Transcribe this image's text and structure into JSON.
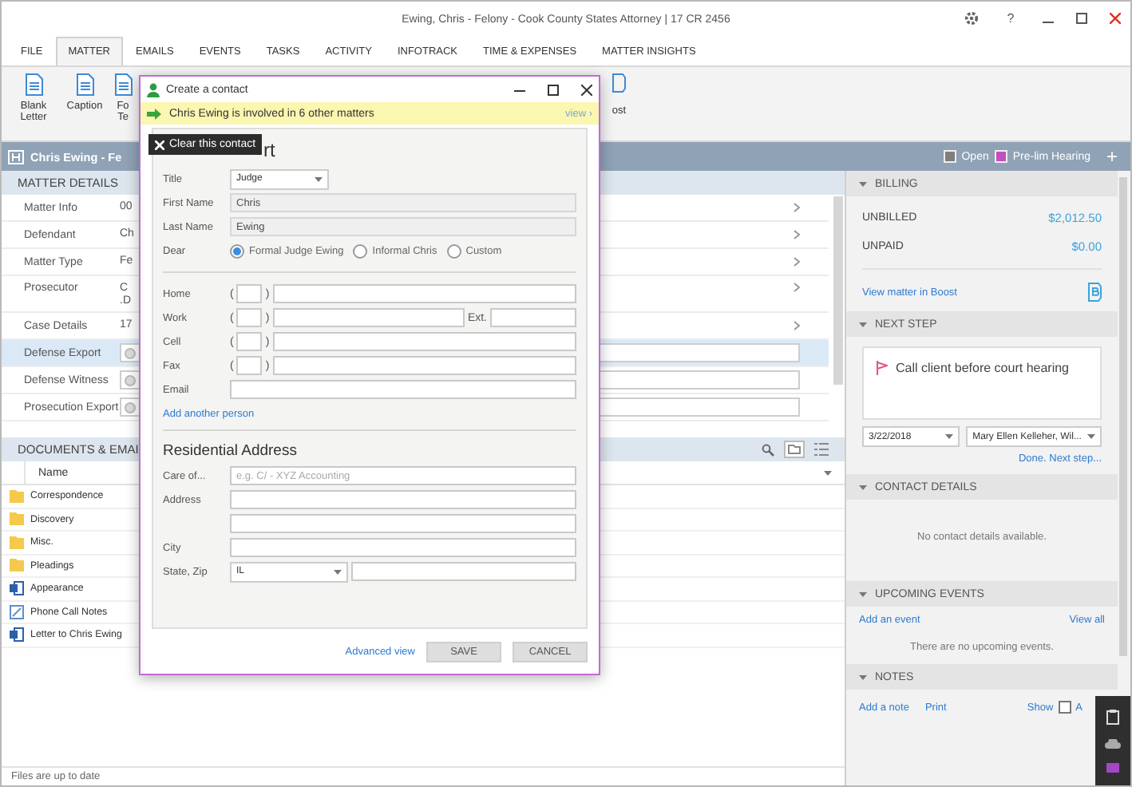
{
  "window": {
    "title": "Ewing, Chris - Felony - Cook County States Attorney | 17 CR 2456",
    "help": "?"
  },
  "menu_tabs": [
    {
      "label": "FILE",
      "selected": false
    },
    {
      "label": "MATTER",
      "selected": true
    },
    {
      "label": "EMAILS",
      "selected": false
    },
    {
      "label": "EVENTS",
      "selected": false
    },
    {
      "label": "TASKS",
      "selected": false
    },
    {
      "label": "ACTIVITY",
      "selected": false
    },
    {
      "label": "INFOTRACK",
      "selected": false
    },
    {
      "label": "TIME & EXPENSES",
      "selected": false
    },
    {
      "label": "MATTER INSIGHTS",
      "selected": false
    }
  ],
  "ribbon": {
    "items": [
      {
        "label": "Blank Letter"
      },
      {
        "label": "Caption"
      },
      {
        "label": "Fo Te"
      }
    ],
    "trailing_label": "ost"
  },
  "matter_bar": {
    "title": "Chris Ewing - Fe",
    "statuses": [
      {
        "label": "Open",
        "color": "#7f7f7f"
      },
      {
        "label": "Pre-lim Hearing",
        "color": "#c24fc1"
      }
    ],
    "add": "+"
  },
  "matter_details": {
    "title": "MATTER DETAILS",
    "rows": [
      {
        "label": "Matter Info",
        "value": "00",
        "kind": "text",
        "selected": false
      },
      {
        "label": "Defendant",
        "value": "Ch",
        "kind": "text",
        "selected": false
      },
      {
        "label": "Matter Type",
        "value": "Fe",
        "kind": "text",
        "selected": false
      },
      {
        "label": "Prosecutor",
        "value": "C .D",
        "kind": "tall",
        "selected": false
      },
      {
        "label": "Case Details",
        "value": "17",
        "kind": "text",
        "selected": false
      },
      {
        "label": "Defense Export",
        "kind": "field",
        "selected": true
      },
      {
        "label": "Defense Witness",
        "kind": "field",
        "selected": false
      },
      {
        "label": "Prosecution Export",
        "kind": "field",
        "selected": false
      }
    ]
  },
  "documents": {
    "title": "DOCUMENTS & EMAI",
    "column": "Name",
    "items": [
      {
        "name": "Correspondence",
        "kind": "folder"
      },
      {
        "name": "Discovery",
        "kind": "folder"
      },
      {
        "name": "Misc.",
        "kind": "folder"
      },
      {
        "name": "Pleadings",
        "kind": "folder"
      },
      {
        "name": "Appearance",
        "kind": "document"
      },
      {
        "name": "Phone Call Notes",
        "kind": "note"
      },
      {
        "name": "Letter to Chris Ewing",
        "kind": "document"
      }
    ],
    "status": "Files are up to date"
  },
  "side_panel": {
    "billing": {
      "title": "BILLING",
      "rows": [
        {
          "label": "UNBILLED",
          "value": "$2,012.50"
        },
        {
          "label": "UNPAID",
          "value": "$0.00"
        }
      ],
      "link": "View matter in Boost"
    },
    "next_step": {
      "title": "NEXT STEP",
      "text": "Call client before court hearing",
      "date": "3/22/2018",
      "assignee": "Mary Ellen Kelleher, Wil...",
      "link": "Done. Next step..."
    },
    "contact_details": {
      "title": "CONTACT DETAILS",
      "empty": "No contact details available."
    },
    "upcoming_events": {
      "title": "UPCOMING EVENTS",
      "add": "Add an event",
      "view_all": "View all",
      "empty": "There are no upcoming events."
    },
    "notes": {
      "title": "NOTES",
      "add": "Add a note",
      "print": "Print",
      "show": "Show",
      "show_checked": false,
      "cut_label": "A"
    }
  },
  "dialog": {
    "title": "Create a contact",
    "banner": "Chris Ewing is involved in 6 other matters",
    "banner_link": "view ›",
    "tooltip": "Clear this contact",
    "heading": "rt",
    "title_field": {
      "label": "Title",
      "value": "Judge"
    },
    "first_name": {
      "label": "First Name",
      "value": "Chris"
    },
    "last_name": {
      "label": "Last Name",
      "value": "Ewing"
    },
    "dear": {
      "label": "Dear",
      "options": [
        {
          "label": "Formal",
          "name": "Judge Ewing",
          "selected": true
        },
        {
          "label": "Informal",
          "name": "Chris",
          "selected": false
        },
        {
          "label": "Custom",
          "selected": false
        }
      ]
    },
    "phones": [
      {
        "label": "Home",
        "open": "(",
        "close": ")"
      },
      {
        "label": "Work",
        "open": "(",
        "close": ")",
        "ext": "Ext."
      },
      {
        "label": "Cell",
        "open": "(",
        "close": ")"
      },
      {
        "label": "Fax",
        "open": "(",
        "close": ")"
      }
    ],
    "email": {
      "label": "Email"
    },
    "add_person": "Add another person",
    "address_title": "Residential Address",
    "care_of": {
      "label": "Care of...",
      "placeholder": "e.g. C/ - XYZ Accounting"
    },
    "address": {
      "label": "Address"
    },
    "city": {
      "label": "City"
    },
    "state_zip": {
      "label": "State, Zip",
      "state": "IL"
    },
    "advanced": "Advanced view",
    "save": "SAVE",
    "cancel": "CANCEL"
  }
}
